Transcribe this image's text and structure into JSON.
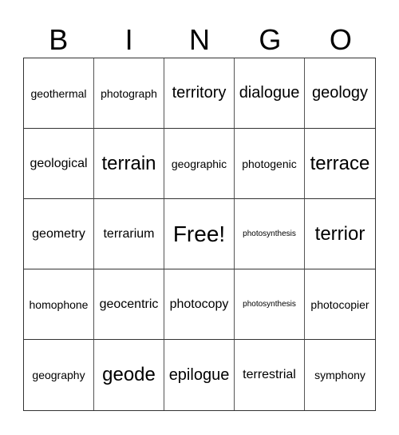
{
  "header": {
    "letters": [
      "B",
      "I",
      "N",
      "G",
      "O"
    ]
  },
  "board": {
    "rows": [
      [
        {
          "word": "geothermal",
          "size": "sm"
        },
        {
          "word": "photograph",
          "size": "sm"
        },
        {
          "word": "territory",
          "size": "lg"
        },
        {
          "word": "dialogue",
          "size": "lg"
        },
        {
          "word": "geology",
          "size": "lg"
        }
      ],
      [
        {
          "word": "geological",
          "size": "md"
        },
        {
          "word": "terrain",
          "size": "xl"
        },
        {
          "word": "geographic",
          "size": "sm"
        },
        {
          "word": "photogenic",
          "size": "sm"
        },
        {
          "word": "terrace",
          "size": "xl"
        }
      ],
      [
        {
          "word": "geometry",
          "size": "md"
        },
        {
          "word": "terrarium",
          "size": "md"
        },
        {
          "word": "Free!",
          "size": "xxl"
        },
        {
          "word": "photosynthesis",
          "size": "xs"
        },
        {
          "word": "terrior",
          "size": "xl"
        }
      ],
      [
        {
          "word": "homophone",
          "size": "sm"
        },
        {
          "word": "geocentric",
          "size": "md"
        },
        {
          "word": "photocopy",
          "size": "md"
        },
        {
          "word": "photosynthesis",
          "size": "xs"
        },
        {
          "word": "photocopier",
          "size": "sm"
        }
      ],
      [
        {
          "word": "geography",
          "size": "sm"
        },
        {
          "word": "geode",
          "size": "xl"
        },
        {
          "word": "epilogue",
          "size": "lg"
        },
        {
          "word": "terrestrial",
          "size": "md"
        },
        {
          "word": "symphony",
          "size": "sm"
        }
      ]
    ]
  }
}
